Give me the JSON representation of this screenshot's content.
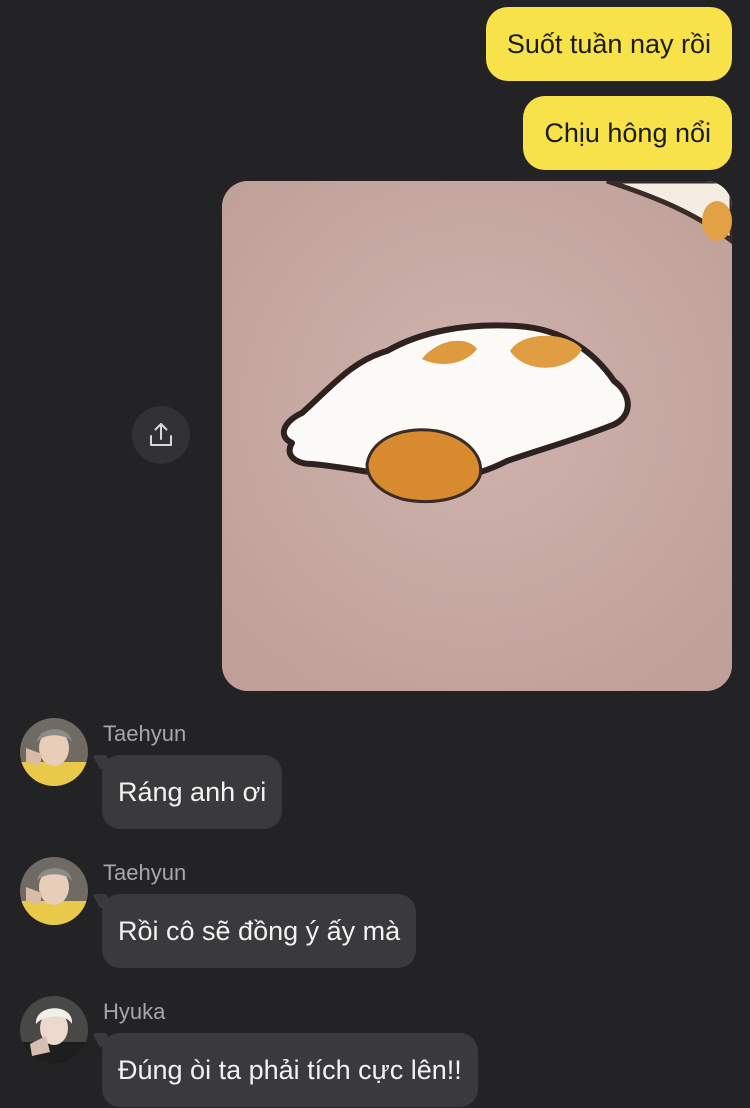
{
  "messages_out": [
    {
      "text": "Suốt tuần nay rồi"
    },
    {
      "text": "Chịu hông nổi"
    }
  ],
  "image_message": {
    "icon": "hamster-sticker-image"
  },
  "share_button": {
    "icon": "share-icon"
  },
  "messages_in": [
    {
      "sender": "Taehyun",
      "text": "Ráng anh ơi"
    },
    {
      "sender": "Taehyun",
      "text": "Rồi cô sẽ đồng ý ấy mà"
    },
    {
      "sender": "Hyuka",
      "text": "Đúng òi ta phải tích cực lên!!"
    }
  ],
  "colors": {
    "background": "#232326",
    "outgoing_bubble": "#f7e349",
    "incoming_bubble": "#3a3a3d",
    "sender_name": "#a7a7ab"
  }
}
